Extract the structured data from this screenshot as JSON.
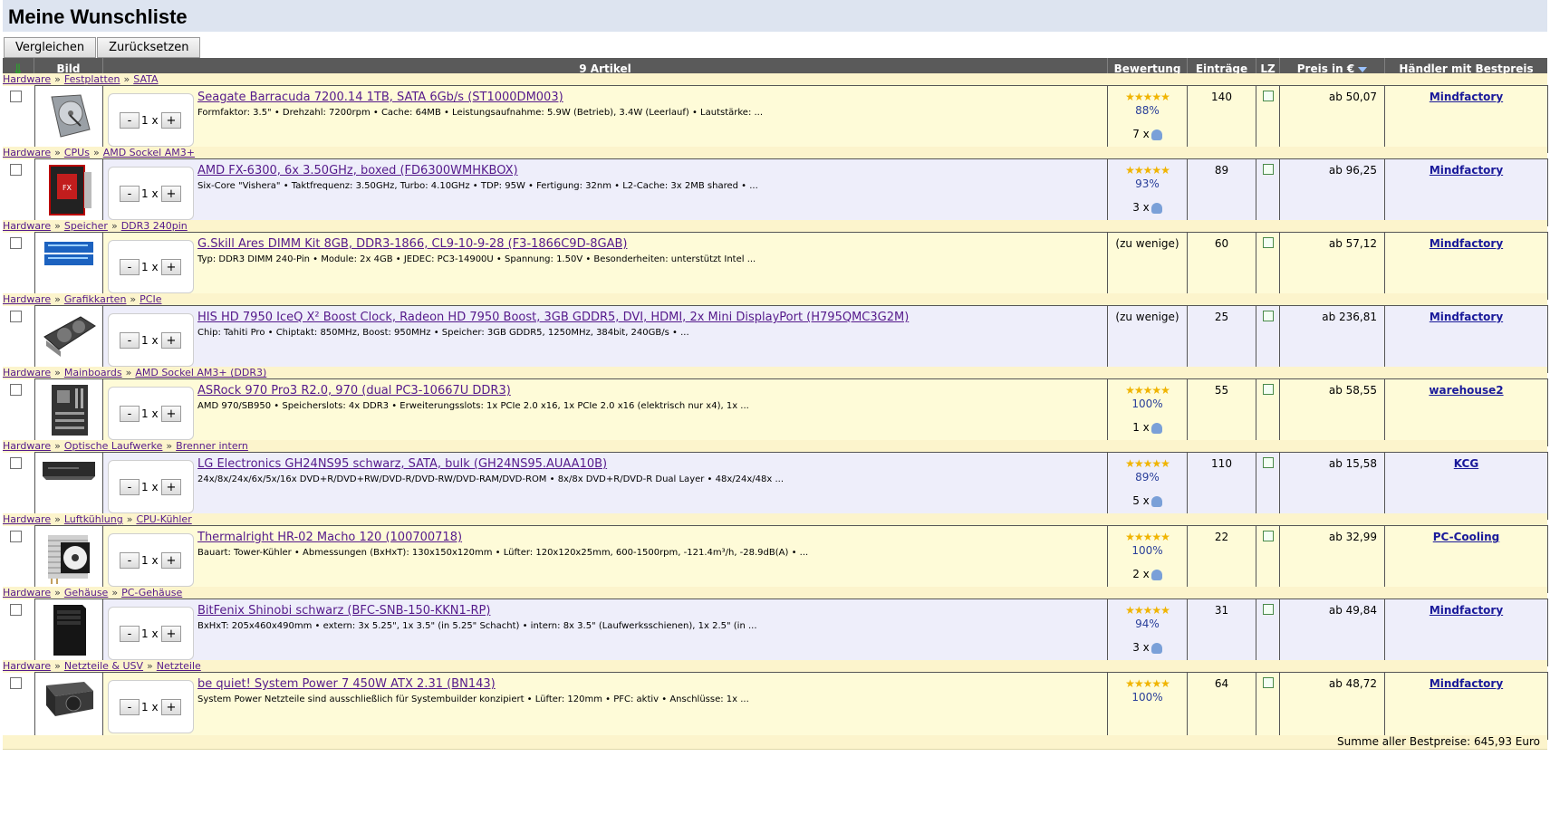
{
  "page_title": "Meine Wunschliste",
  "buttons": {
    "compare": "Vergleichen",
    "reset": "Zurücksetzen"
  },
  "header": {
    "sort_icon": "⇓",
    "image": "Bild",
    "count": "9 Artikel",
    "rating": "Bewertung",
    "entries": "Einträge",
    "lz": "LZ",
    "price": "Preis in €",
    "merchant": "Händler mit Bestpreis"
  },
  "items": [
    {
      "breadcrumb": [
        "Hardware",
        "Festplatten",
        "SATA"
      ],
      "qty": "1",
      "name": "Seagate Barracuda 7200.14 1TB, SATA 6Gb/s (ST1000DM003)",
      "desc": "Formfaktor: 3.5\" • Drehzahl: 7200rpm • Cache: 64MB • Leistungsaufnahme: 5.9W (Betrieb), 3.4W (Leerlauf) • Lautstärke: ...",
      "stars": 4.5,
      "rating": "88%",
      "ratings_count": "7 x",
      "entries": "140",
      "price": "ab 50,07",
      "merchant": "Mindfactory",
      "thumb": "hdd"
    },
    {
      "breadcrumb": [
        "Hardware",
        "CPUs",
        "AMD Sockel AM3+"
      ],
      "qty": "1",
      "name": "AMD FX-6300, 6x 3.50GHz, boxed (FD6300WMHKBOX)",
      "desc": "Six-Core \"Vishera\" • Taktfrequenz: 3.50GHz, Turbo: 4.10GHz • TDP: 95W • Fertigung: 32nm • L2-Cache: 3x 2MB shared • ...",
      "stars": 5,
      "rating": "93%",
      "ratings_count": "3 x",
      "entries": "89",
      "price": "ab 96,25",
      "merchant": "Mindfactory",
      "thumb": "cpu"
    },
    {
      "breadcrumb": [
        "Hardware",
        "Speicher",
        "DDR3 240pin"
      ],
      "qty": "1",
      "name": "G.Skill Ares DIMM Kit 8GB, DDR3-1866, CL9-10-9-28 (F3-1866C9D-8GAB)",
      "desc": "Typ: DDR3 DIMM 240-Pin • Module: 2x 4GB • JEDEC: PC3-14900U • Spannung: 1.50V • Besonderheiten: unterstützt Intel ...",
      "stars": 0,
      "rating": "(zu wenige)",
      "ratings_count": "",
      "entries": "60",
      "price": "ab 57,12",
      "merchant": "Mindfactory",
      "thumb": "ram"
    },
    {
      "breadcrumb": [
        "Hardware",
        "Grafikkarten",
        "PCIe"
      ],
      "qty": "1",
      "name": "HIS HD 7950 IceQ X² Boost Clock, Radeon HD 7950 Boost, 3GB GDDR5, DVI, HDMI, 2x Mini DisplayPort (H795QMC3G2M)",
      "desc": "Chip: Tahiti Pro • Chiptakt: 850MHz, Boost: 950MHz • Speicher: 3GB GDDR5, 1250MHz, 384bit, 240GB/s • ...",
      "stars": 0,
      "rating": "(zu wenige)",
      "ratings_count": "",
      "entries": "25",
      "price": "ab 236,81",
      "merchant": "Mindfactory",
      "thumb": "gpu"
    },
    {
      "breadcrumb": [
        "Hardware",
        "Mainboards",
        "AMD Sockel AM3+ (DDR3)"
      ],
      "qty": "1",
      "name": "ASRock 970 Pro3 R2.0, 970 (dual PC3-10667U DDR3)",
      "desc": "AMD 970/SB950 • Speicherslots: 4x DDR3 • Erweiterungsslots: 1x PCIe 2.0 x16, 1x PCIe 2.0 x16 (elektrisch nur x4), 1x ...",
      "stars": 5,
      "rating": "100%",
      "ratings_count": "1 x",
      "entries": "55",
      "price": "ab 58,55",
      "merchant": "warehouse2",
      "thumb": "mb"
    },
    {
      "breadcrumb": [
        "Hardware",
        "Optische Laufwerke",
        "Brenner intern"
      ],
      "qty": "1",
      "name": "LG Electronics GH24NS95 schwarz, SATA, bulk (GH24NS95.AUAA10B)",
      "desc": "24x/8x/24x/6x/5x/16x DVD+R/DVD+RW/DVD-R/DVD-RW/DVD-RAM/DVD-ROM • 8x/8x DVD+R/DVD-R Dual Layer • 48x/24x/48x ...",
      "stars": 4.5,
      "rating": "89%",
      "ratings_count": "5 x",
      "entries": "110",
      "price": "ab 15,58",
      "merchant": "KCG",
      "thumb": "odd"
    },
    {
      "breadcrumb": [
        "Hardware",
        "Luftkühlung",
        "CPU-Kühler"
      ],
      "qty": "1",
      "name": "Thermalright HR-02 Macho 120 (100700718)",
      "desc": "Bauart: Tower-Kühler • Abmessungen (BxHxT): 130x150x120mm • Lüfter: 120x120x25mm, 600-1500rpm, -121.4m³/h, -28.9dB(A) • ...",
      "stars": 5,
      "rating": "100%",
      "ratings_count": "2 x",
      "entries": "22",
      "price": "ab 32,99",
      "merchant": "PC-Cooling",
      "thumb": "cooler"
    },
    {
      "breadcrumb": [
        "Hardware",
        "Gehäuse",
        "PC-Gehäuse"
      ],
      "qty": "1",
      "name": "BitFenix Shinobi schwarz (BFC-SNB-150-KKN1-RP)",
      "desc": "BxHxT: 205x460x490mm • extern: 3x 5.25\", 1x 3.5\" (in 5.25\" Schacht) • intern: 8x 3.5\" (Laufwerksschienen), 1x 2.5\" (in ...",
      "stars": 5,
      "rating": "94%",
      "ratings_count": "3 x",
      "entries": "31",
      "price": "ab 49,84",
      "merchant": "Mindfactory",
      "thumb": "case"
    },
    {
      "breadcrumb": [
        "Hardware",
        "Netzteile & USV",
        "Netzteile"
      ],
      "qty": "1",
      "name": "be quiet! System Power 7 450W ATX 2.31 (BN143)",
      "desc": "System Power Netzteile sind ausschließlich für Systembuilder konzipiert • Lüfter: 120mm • PFC: aktiv • Anschlüsse: 1x ...",
      "stars": 5,
      "rating": "100%",
      "ratings_count": "",
      "entries": "64",
      "price": "ab 48,72",
      "merchant": "Mindfactory",
      "thumb": "psu"
    }
  ],
  "footer": "Summe aller Bestpreise: 645,93 Euro"
}
